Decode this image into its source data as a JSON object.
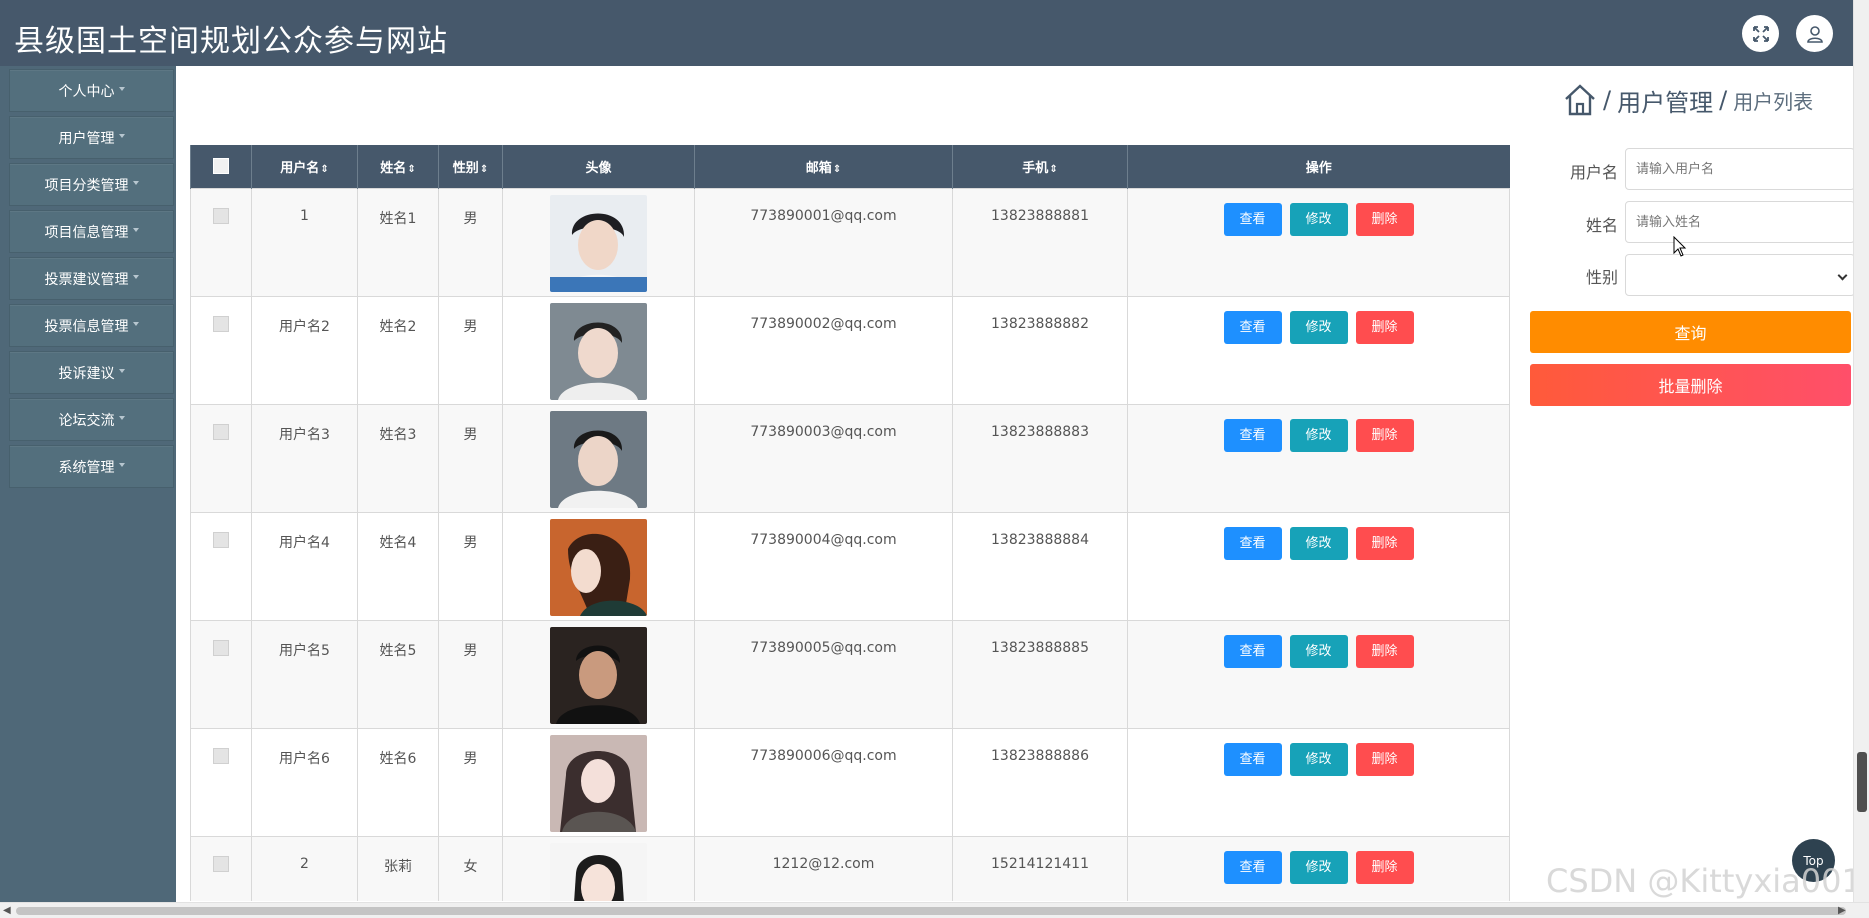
{
  "header": {
    "title": "县级国土空间规划公众参与网站",
    "icons": [
      "fullscreen-icon",
      "user-icon"
    ]
  },
  "sidebar": {
    "items": [
      {
        "label": "个人中心"
      },
      {
        "label": "用户管理"
      },
      {
        "label": "项目分类管理"
      },
      {
        "label": "项目信息管理"
      },
      {
        "label": "投票建议管理"
      },
      {
        "label": "投票信息管理"
      },
      {
        "label": "投诉建议"
      },
      {
        "label": "论坛交流"
      },
      {
        "label": "系统管理"
      }
    ]
  },
  "breadcrumb": {
    "home_icon": "home-icon",
    "sep": "/",
    "level1": "用户管理",
    "level2": "用户列表"
  },
  "table": {
    "columns": [
      "",
      "用户名",
      "姓名",
      "性别",
      "头像",
      "邮箱",
      "手机",
      "操作"
    ],
    "sortable": [
      "用户名",
      "姓名",
      "性别",
      "邮箱",
      "手机"
    ],
    "actions": {
      "view": "查看",
      "edit": "修改",
      "delete": "删除"
    },
    "rows": [
      {
        "username": "1",
        "name": "姓名1",
        "gender": "男",
        "email": "773890001@qq.com",
        "phone": "13823888881"
      },
      {
        "username": "用户名2",
        "name": "姓名2",
        "gender": "男",
        "email": "773890002@qq.com",
        "phone": "13823888882"
      },
      {
        "username": "用户名3",
        "name": "姓名3",
        "gender": "男",
        "email": "773890003@qq.com",
        "phone": "13823888883"
      },
      {
        "username": "用户名4",
        "name": "姓名4",
        "gender": "男",
        "email": "773890004@qq.com",
        "phone": "13823888884"
      },
      {
        "username": "用户名5",
        "name": "姓名5",
        "gender": "男",
        "email": "773890005@qq.com",
        "phone": "13823888885"
      },
      {
        "username": "用户名6",
        "name": "姓名6",
        "gender": "男",
        "email": "773890006@qq.com",
        "phone": "13823888886"
      },
      {
        "username": "2",
        "name": "张莉",
        "gender": "女",
        "email": "1212@12.com",
        "phone": "15214121411"
      }
    ]
  },
  "search": {
    "username_label": "用户名",
    "username_placeholder": "请输入用户名",
    "name_label": "姓名",
    "name_placeholder": "请输入姓名",
    "gender_label": "性别",
    "gender_value": "",
    "query_button": "查询",
    "batch_delete_button": "批量删除"
  },
  "top_button": "Top",
  "watermark": "CSDN @Kittyxia001"
}
